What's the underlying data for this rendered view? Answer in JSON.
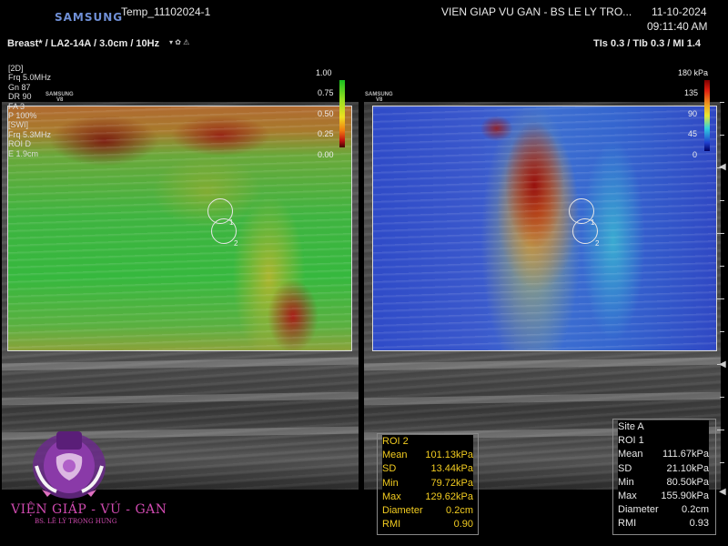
{
  "header": {
    "brand": "SAMSUNG",
    "patient_id": "Temp_11102024-1",
    "institution": "VIEN GIAP VU GAN - BS LE LY TRO...",
    "date": "11-10-2024",
    "time": "09:11:40 AM",
    "preset": "Breast* / LA2-14A / 3.0cm / 10Hz",
    "tis_label": "TIs  0.3 / TIb  0.3 / MI    1.4"
  },
  "params": [
    "[2D]",
    "Frq  5.0MHz",
    "Gn   87",
    "DR   90",
    "FA   3",
    "P    100%",
    "[SWI]",
    "Frq  5.3MHz",
    "ROI D",
    "E    1.9cm"
  ],
  "strain_scale": {
    "top": "1.00",
    "l1": "0.75",
    "l2": "0.50",
    "l3": "0.25",
    "bottom": "0.00"
  },
  "swe_scale": {
    "top": "180 kPa",
    "l1": "135",
    "l2": "90",
    "l3": "45",
    "bottom": "0"
  },
  "roi_labels": {
    "one": "1",
    "two": "2"
  },
  "mini_logo": "SAMSUNG",
  "mini_logo_sub": "V8",
  "roi2": {
    "title": "ROI 2",
    "rows": [
      {
        "label": "Mean",
        "value": "101.13kPa"
      },
      {
        "label": "SD",
        "value": "13.44kPa"
      },
      {
        "label": "Min",
        "value": "79.72kPa"
      },
      {
        "label": "Max",
        "value": "129.62kPa"
      },
      {
        "label": "Diameter",
        "value": "0.2cm"
      },
      {
        "label": "RMI",
        "value": "0.90"
      }
    ]
  },
  "roi1": {
    "site": "Site A",
    "title": "ROI 1",
    "rows": [
      {
        "label": "Mean",
        "value": "111.67kPa"
      },
      {
        "label": "SD",
        "value": "21.10kPa"
      },
      {
        "label": "Min",
        "value": "80.50kPa"
      },
      {
        "label": "Max",
        "value": "155.90kPa"
      },
      {
        "label": "Diameter",
        "value": "0.2cm"
      },
      {
        "label": "RMI",
        "value": "0.93"
      }
    ]
  },
  "clinic_logo": {
    "name": "VIỆN GIÁP - VÚ - GAN",
    "sub": "BS. LÊ LÝ TRỌNG HƯNG"
  },
  "colors": {
    "roi2_text": "#f2cc20",
    "logo_magenta": "#d04ab0",
    "brand_blue": "#6f8fd6"
  }
}
